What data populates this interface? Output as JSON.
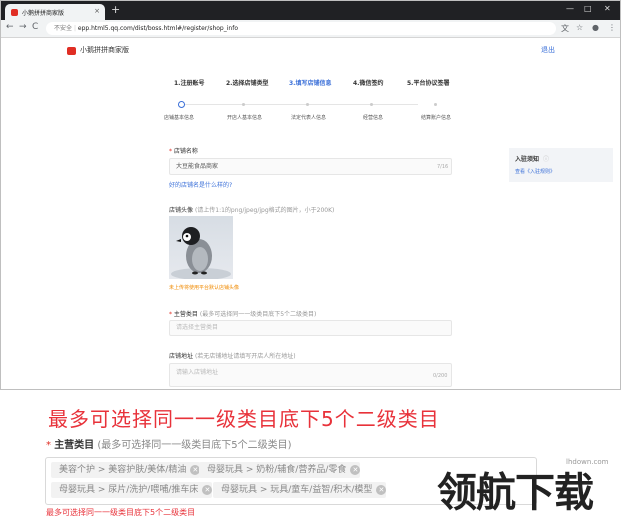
{
  "browser": {
    "tab_title": "小鹅拼拼商家版",
    "tab_close": "×",
    "new_tab": "+",
    "win_min": "—",
    "win_max": "□",
    "win_close": "✕",
    "back": "←",
    "forward": "→",
    "reload": "C",
    "security": "不安全",
    "url": "epp.html5.qq.com/dist/boss.html#/register/shop_info",
    "ext_translate": "文",
    "ext_star": "☆",
    "ext_account": "●",
    "ext_menu": "⋮"
  },
  "header": {
    "brand": "小鹅拼拼商家版",
    "logout": "退出"
  },
  "steps": [
    {
      "label": "1.注册账号",
      "active": false
    },
    {
      "label": "2.选择店铺类型",
      "active": false
    },
    {
      "label": "3.填写店铺信息",
      "active": true
    },
    {
      "label": "4.微信签约",
      "active": false
    },
    {
      "label": "5.平台协议签署",
      "active": false
    }
  ],
  "substeps": [
    "店铺基本信息",
    "开店人基本信息",
    "法定代表人信息",
    "经营信息",
    "结算账户信息"
  ],
  "form": {
    "shop_name_label": "店铺名称",
    "shop_name_value": "大豆能食品商家",
    "shop_name_count": "7/16",
    "shop_name_tip": "好的店铺名是什么样的?",
    "avatar_label": "店铺头像",
    "avatar_hint": "(请上传1:1的png/jpeg/jpg格式的图片，小于200K)",
    "avatar_tip": "未上传将使用平台默认店铺头像",
    "category_label": "主营类目",
    "category_hint": "(最多可选择同一一级类目底下5个二级类目)",
    "category_placeholder": "请选择主营类目",
    "address_label": "店铺地址",
    "address_hint": "(若无店铺地址请填写开店人所在地址)",
    "address_placeholder": "请输入店铺地址",
    "address_count": "0/200"
  },
  "sidebar": {
    "title": "入驻须知",
    "link": "查看《入驻规则》"
  },
  "zoom": {
    "heading": "最多可选择同一一级类目底下5个二级类目",
    "label": "主营类目",
    "hint": "(最多可选择同一一级类目底下5个二级类目)",
    "tags": [
      "美容个护 > 美容护肤/美体/精油",
      "母婴玩具 > 奶粉/辅食/营养品/零食",
      "母婴玩具 > 尿片/洗护/喂哺/推车床",
      "母婴玩具 > 玩具/童车/益智/积木/模型"
    ],
    "tag_close": "✕",
    "error": "最多可选择同一一级类目底下5个二级类目"
  },
  "watermark": {
    "text": "领航下载",
    "url": "lhdown.com"
  },
  "colors": {
    "accent": "#3a6fd8",
    "brand_red": "#e02e24",
    "error": "#e8323a"
  }
}
